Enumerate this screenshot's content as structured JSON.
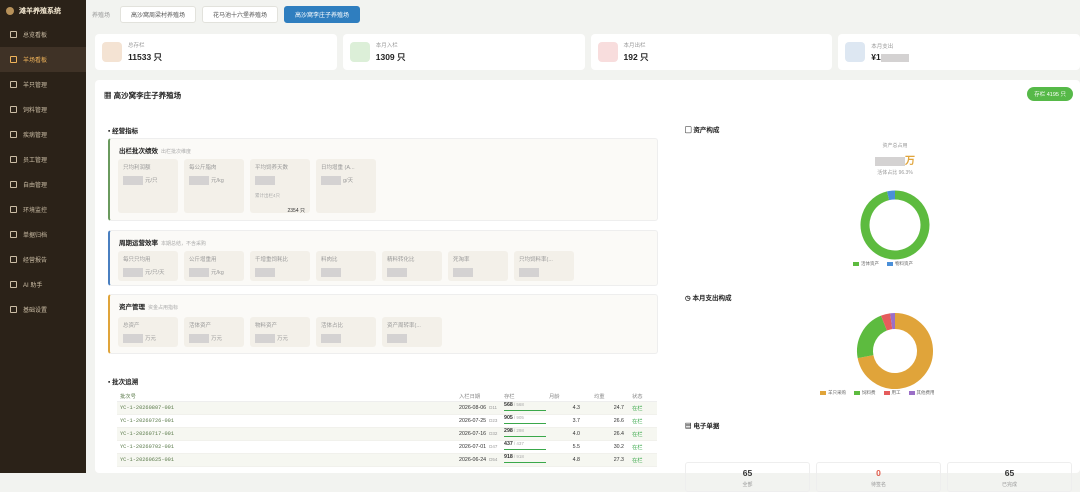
{
  "app": {
    "title": "滩羊养殖系统"
  },
  "sidebar": {
    "items": [
      {
        "label": "总览看板",
        "icon": "dashboard-icon"
      },
      {
        "label": "羊场看板",
        "icon": "home-icon",
        "active": true
      },
      {
        "label": "羊只管理",
        "icon": "sheep-icon"
      },
      {
        "label": "饲料管理",
        "icon": "feed-icon"
      },
      {
        "label": "疾病管理",
        "icon": "medical-icon"
      },
      {
        "label": "员工管理",
        "icon": "user-icon"
      },
      {
        "label": "自由管理",
        "icon": "manage-icon"
      },
      {
        "label": "环境监控",
        "icon": "monitor-icon"
      },
      {
        "label": "单据归档",
        "icon": "document-icon"
      },
      {
        "label": "经营报告",
        "icon": "report-icon"
      },
      {
        "label": "AI 助手",
        "icon": "ai-icon"
      },
      {
        "label": "基础设置",
        "icon": "settings-icon"
      }
    ]
  },
  "tabs": {
    "crumb": "养殖场",
    "items": [
      "高沙窝周梁村养殖场",
      "花马池十六堡养殖场",
      "高沙窝李庄子养殖场"
    ],
    "active_index": 2
  },
  "stats": [
    {
      "label": "总存栏",
      "value": "11533 只",
      "color": "#f4e3d3"
    },
    {
      "label": "本月入栏",
      "value": "1309 只",
      "color": "#dcefd8"
    },
    {
      "label": "本月出栏",
      "value": "192 只",
      "color": "#f8dddd"
    },
    {
      "label": "本月支出",
      "value": "¥1",
      "color": "#dde7f2"
    }
  ],
  "farm": {
    "title": "高沙窝李庄子养殖场",
    "badge": "存栏 4195 只"
  },
  "business": {
    "title": "经营指标"
  },
  "card1": {
    "title": "出栏批次绩效",
    "sub": "出栏批次维度",
    "metrics": [
      {
        "label": "只均利润额",
        "unit": "元/只"
      },
      {
        "label": "每公斤脂肉",
        "unit": "元/kg"
      },
      {
        "label": "平均饲养天数",
        "unit": "",
        "note": "累计出栏4只",
        "sum": "2354 只"
      },
      {
        "label": "日均增重 (A...",
        "unit": "g/天"
      }
    ]
  },
  "card2": {
    "title": "周期运营效率",
    "sub": "本期总结，不含采购",
    "metrics": [
      {
        "label": "每只只均用",
        "unit": "元/只/天"
      },
      {
        "label": "公斤增重用",
        "unit": "元/kg"
      },
      {
        "label": "千增重饲耗比",
        "unit": ""
      },
      {
        "label": "料肉比",
        "unit": ""
      },
      {
        "label": "精料转化比",
        "unit": ""
      },
      {
        "label": "死淘率",
        "unit": ""
      },
      {
        "label": "只均饲料率(...",
        "unit": ""
      }
    ]
  },
  "card3": {
    "title": "资产管理",
    "sub": "资金占用指标",
    "metrics": [
      {
        "label": "总资产",
        "unit": "万元"
      },
      {
        "label": "活体资产",
        "unit": "万元"
      },
      {
        "label": "物料资产",
        "unit": "万元"
      },
      {
        "label": "活体占比",
        "unit": ""
      },
      {
        "label": "资产周转率(...",
        "unit": ""
      }
    ]
  },
  "batch": {
    "title": "批次追溯",
    "headers": [
      "批次号",
      "入栏日期",
      "存栏",
      "月龄",
      "均重",
      "状态"
    ],
    "rows": [
      {
        "id": "YC-1-20260807-001",
        "date": "2026-08-06",
        "day": "D11",
        "stock": "568",
        "total": "/ 568",
        "age": "4.3",
        "weight": "24.7",
        "status": "在栏"
      },
      {
        "id": "YC-1-20260726-001",
        "date": "2026-07-25",
        "day": "D23",
        "stock": "905",
        "total": "/ 905",
        "age": "3.7",
        "weight": "26.6",
        "status": "在栏"
      },
      {
        "id": "YC-1-20260717-001",
        "date": "2026-07-16",
        "day": "D32",
        "stock": "298",
        "total": "/ 298",
        "age": "4.0",
        "weight": "26.4",
        "status": "在栏"
      },
      {
        "id": "YC-1-20260702-001",
        "date": "2026-07-01",
        "day": "D47",
        "stock": "437",
        "total": "/ 437",
        "age": "5.5",
        "weight": "30.2",
        "status": "在栏"
      },
      {
        "id": "YC-1-20260625-001",
        "date": "2026-06-24",
        "day": "D54",
        "stock": "918",
        "total": "/ 918",
        "age": "4.8",
        "weight": "27.3",
        "status": "在栏"
      }
    ]
  },
  "asset_chart": {
    "title": "资产构成",
    "center_label": "资产总占用",
    "center_unit": "万",
    "center_sub": "活体占比 96.3%",
    "legend": [
      "活体资产",
      "物料资产"
    ],
    "colors": [
      "#5dbb3f",
      "#4a8fd8"
    ]
  },
  "expense_chart": {
    "title": "本月支出构成",
    "legend": [
      "羊只采购",
      "饲料费",
      "用工",
      "其他费用"
    ],
    "colors": [
      "#e0a43a",
      "#5dbb3f",
      "#e55c5c",
      "#9b6fc7"
    ]
  },
  "chart_data": [
    {
      "type": "pie",
      "title": "资产构成",
      "labels": [
        "活体资产",
        "物料资产"
      ],
      "values": [
        96.3,
        3.7
      ]
    },
    {
      "type": "pie",
      "title": "本月支出构成",
      "labels": [
        "羊只采购",
        "饲料费",
        "用工",
        "其他费用"
      ],
      "values": [
        72,
        22,
        4,
        2
      ]
    }
  ],
  "docs": {
    "title": "电子单据",
    "items": [
      {
        "value": "65",
        "label": "全部",
        "color": "#222"
      },
      {
        "value": "0",
        "label": "待签名",
        "color": "#e05b4b"
      },
      {
        "value": "65",
        "label": "已完成",
        "color": "#222"
      }
    ]
  }
}
